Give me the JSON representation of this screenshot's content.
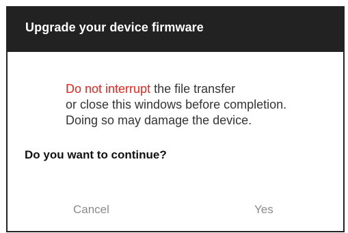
{
  "dialog": {
    "title": "Upgrade your device firmware",
    "message": {
      "line1_warning": "Do not interrupt",
      "line1_rest": " the file transfer",
      "line2": "or close this windows before completion.",
      "line3": "Doing so may damage the device."
    },
    "question": "Do you want to continue?",
    "buttons": {
      "cancel": "Cancel",
      "yes": "Yes"
    }
  },
  "colors": {
    "header_bg": "#222222",
    "warning": "#e8251d",
    "button_text": "#8a8a8a"
  }
}
